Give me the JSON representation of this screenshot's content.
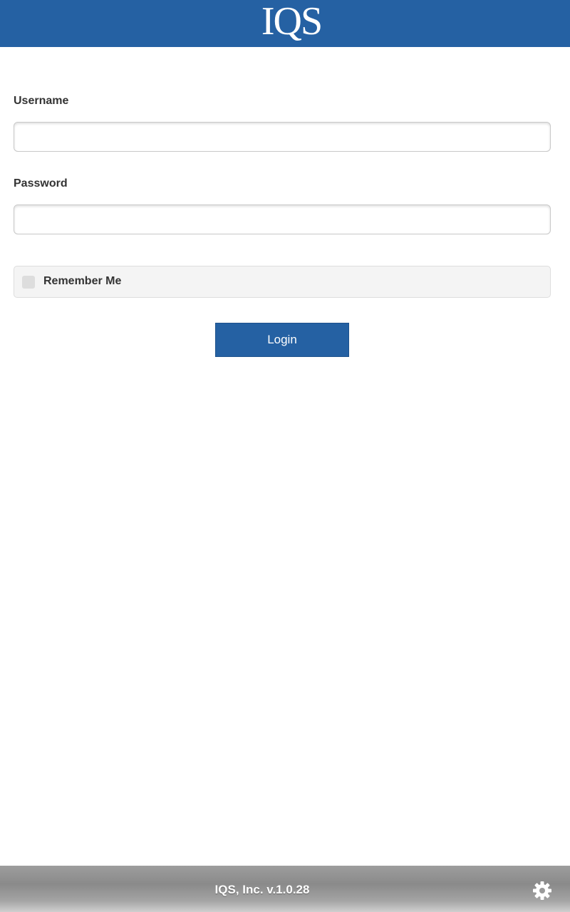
{
  "header": {
    "logo_text": "IQS",
    "background_color": "#2561a3"
  },
  "login_form": {
    "username_label": "Username",
    "username_value": "",
    "password_label": "Password",
    "password_value": "",
    "remember_me_label": "Remember Me",
    "remember_me_checked": false,
    "login_button_label": "Login"
  },
  "footer": {
    "company_version": "IQS, Inc. v.1.0.28",
    "settings_icon": "gear-icon"
  }
}
